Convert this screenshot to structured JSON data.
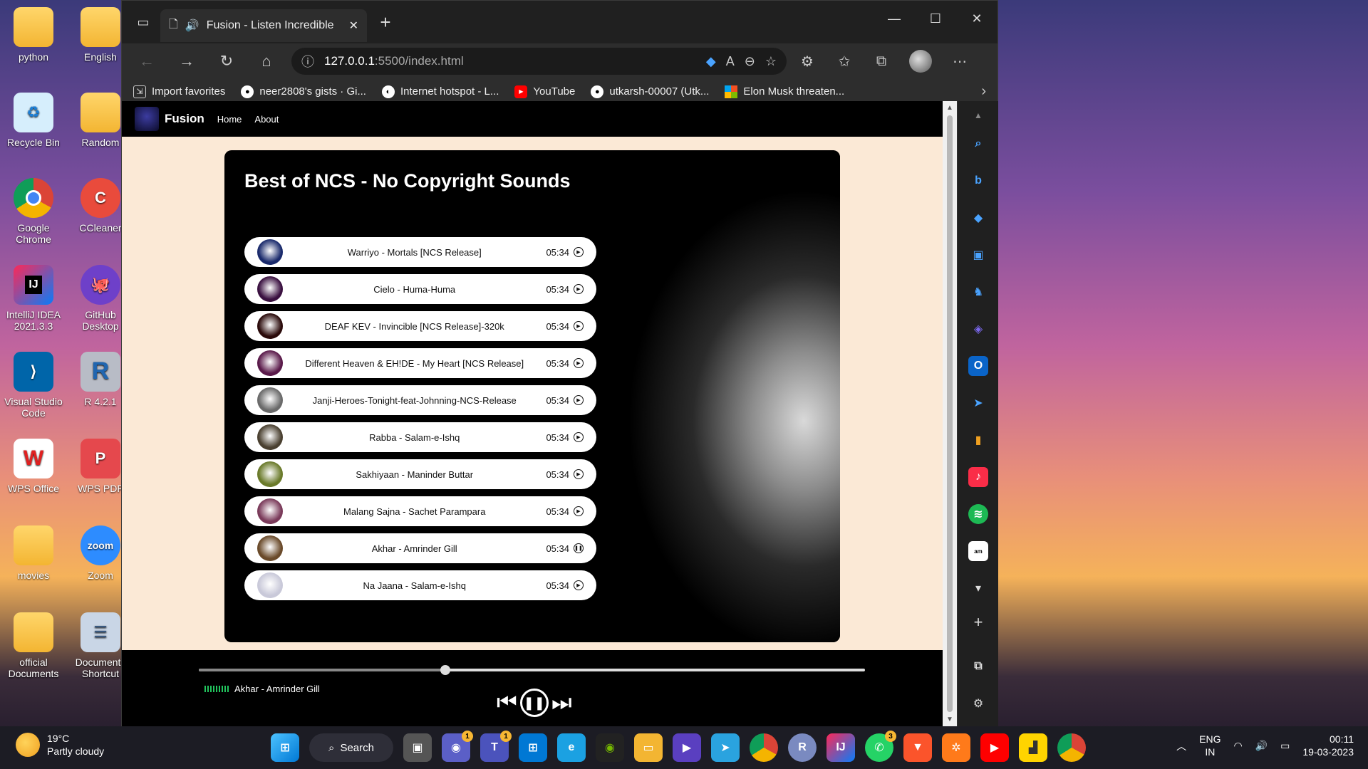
{
  "desktop": {
    "icons": [
      {
        "label": "python"
      },
      {
        "label": "English"
      },
      {
        "label": "Recycle Bin"
      },
      {
        "label": "Random"
      },
      {
        "label": "Google Chrome"
      },
      {
        "label": "CCleaner"
      },
      {
        "label": "IntelliJ IDEA 2021.3.3"
      },
      {
        "label": "GitHub Desktop"
      },
      {
        "label": "Visual Studio Code"
      },
      {
        "label": "R 4.2.1"
      },
      {
        "label": "WPS Office"
      },
      {
        "label": "WPS PDF"
      },
      {
        "label": "movies"
      },
      {
        "label": "Zoom"
      },
      {
        "label": "official Documents"
      },
      {
        "label": "Documents Shortcut"
      }
    ]
  },
  "browser": {
    "tab_title": "Fusion - Listen Incredible",
    "url_host": "127.0.0.1",
    "url_path": ":5500/index.html",
    "favorites": [
      {
        "label": "Import favorites",
        "color": "#cccccc"
      },
      {
        "label": "neer2808's gists · Gi...",
        "color": "#ffffff"
      },
      {
        "label": "Internet hotspot - L...",
        "color": "#ffffff"
      },
      {
        "label": "YouTube",
        "color": "#ff0000"
      },
      {
        "label": "utkarsh-00007 (Utk...",
        "color": "#ffffff"
      },
      {
        "label": "Elon Musk threaten...",
        "color": "#f25022"
      }
    ]
  },
  "site": {
    "brand": "Fusion",
    "nav": {
      "home": "Home",
      "about": "About"
    },
    "heading": "Best of NCS - No Copyright Sounds",
    "songs": [
      {
        "name": "Warriyo - Mortals [NCS Release]",
        "duration": "05:34",
        "state": "play",
        "cover_color": "#1a2a6c"
      },
      {
        "name": "Cielo - Huma-Huma",
        "duration": "05:34",
        "state": "play",
        "cover_color": "#3a1040"
      },
      {
        "name": "DEAF KEV - Invincible [NCS Release]-320k",
        "duration": "05:34",
        "state": "play",
        "cover_color": "#2a0a0a"
      },
      {
        "name": "Different Heaven & EH!DE - My Heart [NCS Release]",
        "duration": "05:34",
        "state": "play",
        "cover_color": "#5a1a4a"
      },
      {
        "name": "Janji-Heroes-Tonight-feat-Johnning-NCS-Release",
        "duration": "05:34",
        "state": "play",
        "cover_color": "#6a6a6a"
      },
      {
        "name": "Rabba - Salam-e-Ishq",
        "duration": "05:34",
        "state": "play",
        "cover_color": "#4a4030"
      },
      {
        "name": "Sakhiyaan - Maninder Buttar",
        "duration": "05:34",
        "state": "play",
        "cover_color": "#6a7a2a"
      },
      {
        "name": "Malang Sajna - Sachet Parampara",
        "duration": "05:34",
        "state": "play",
        "cover_color": "#7a3a5a"
      },
      {
        "name": "Akhar - Amrinder Gill",
        "duration": "05:34",
        "state": "pause",
        "cover_color": "#6a4a2a"
      },
      {
        "name": "Na Jaana - Salam-e-Ishq",
        "duration": "05:34",
        "state": "play",
        "cover_color": "#c9c9d9"
      }
    ],
    "player": {
      "now_playing": "Akhar - Amrinder Gill",
      "progress_fraction": 0.37
    }
  },
  "taskbar": {
    "weather_temp": "19°C",
    "weather_desc": "Partly cloudy",
    "search_label": "Search",
    "lang_top": "ENG",
    "lang_bottom": "IN",
    "time": "00:11",
    "date": "19-03-2023",
    "badges": {
      "chat": "1",
      "teams": "1",
      "whatsapp": "3"
    }
  }
}
